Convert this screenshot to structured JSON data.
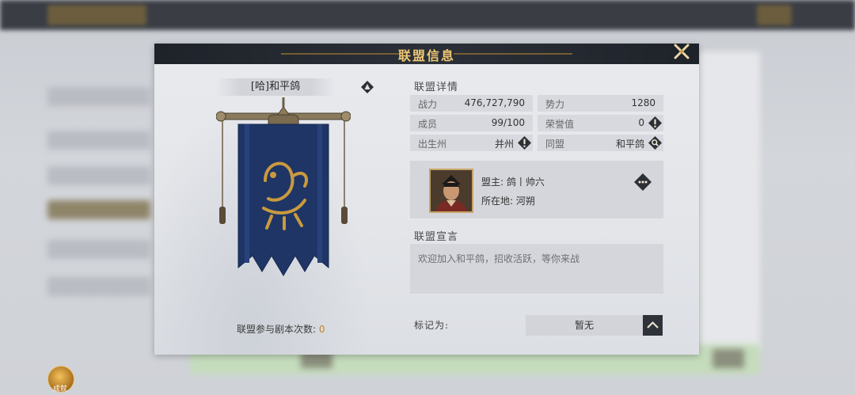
{
  "dialog": {
    "title": "联盟信息"
  },
  "alliance": {
    "name_tag": "[哈]和平鸽",
    "raid_count_label": "联盟参与剧本次数:",
    "raid_count_value": "0"
  },
  "details": {
    "section_title": "联盟详情",
    "stats": [
      {
        "label": "战力",
        "value": "476,727,790"
      },
      {
        "label": "势力",
        "value": "1280"
      },
      {
        "label": "成员",
        "value": "99/100"
      },
      {
        "label": "荣誉值",
        "value": "0",
        "icon": "info-icon"
      },
      {
        "label": "出生州",
        "value": "并州",
        "icon": "info-icon"
      },
      {
        "label": "同盟",
        "value": "和平鸽",
        "icon": "search-icon"
      }
    ]
  },
  "leader": {
    "name_line": "盟主: 鸽丨帅六",
    "location_line": "所在地: 河朔"
  },
  "declaration": {
    "section_title": "联盟宣言",
    "text": "欢迎加入和平鸽，招收活跃，等你来战"
  },
  "mark": {
    "label": "标记为:",
    "value": "暂无"
  },
  "background": {
    "coin_label": "成就"
  },
  "colors": {
    "title_gold": "#f0c874",
    "banner_blue": "#1f3566",
    "emblem_gold": "#c99a3e",
    "raid_value_orange": "#c5822c"
  }
}
